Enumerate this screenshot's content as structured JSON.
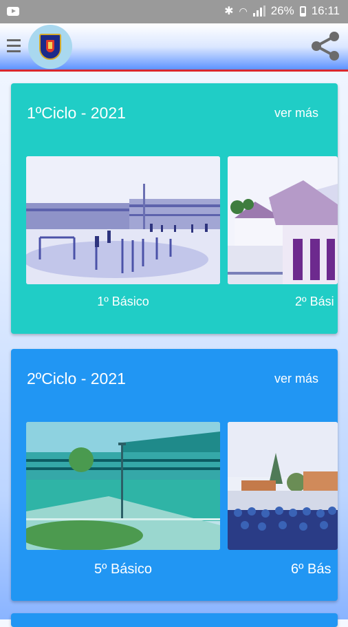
{
  "status_bar": {
    "battery": "26%",
    "time": "16:11"
  },
  "app_bar": {
    "menu_icon": "hamburger-menu-icon",
    "logo_icon": "school-crest-icon",
    "share_icon": "share-icon"
  },
  "sections": [
    {
      "title": "1ºCiclo - 2021",
      "more_label": "ver más",
      "items": [
        {
          "label": "1º Básico"
        },
        {
          "label": "2º Bási"
        }
      ]
    },
    {
      "title": "2ºCiclo - 2021",
      "more_label": "ver más",
      "items": [
        {
          "label": "5º Básico"
        },
        {
          "label": "6º Bás"
        }
      ]
    }
  ]
}
